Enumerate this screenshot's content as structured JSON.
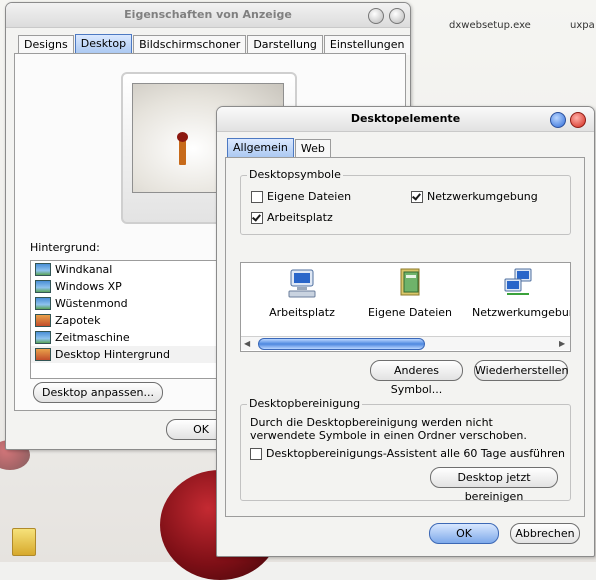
{
  "desktop": {
    "icon_labels": [
      "dxwebsetup.exe",
      "uxpa"
    ]
  },
  "display_properties": {
    "title": "Eigenschaften von Anzeige",
    "tabs": [
      "Designs",
      "Desktop",
      "Bildschirmschoner",
      "Darstellung",
      "Einstellungen"
    ],
    "active_tab": "Desktop",
    "background_label": "Hintergrund:",
    "backgrounds": [
      "Windkanal",
      "Windows XP",
      "Wüstenmond",
      "Zapotek",
      "Zeitmaschine",
      "Desktop Hintergrund"
    ],
    "customize_button": "Desktop anpassen...",
    "ok_button": "OK"
  },
  "desktop_items": {
    "title": "Desktopelemente",
    "tabs": [
      "Allgemein",
      "Web"
    ],
    "active_tab": "Allgemein",
    "icons_group": "Desktopsymbole",
    "checkboxes": [
      {
        "label": "Eigene Dateien",
        "checked": false
      },
      {
        "label": "Netzwerkumgebung",
        "checked": true
      },
      {
        "label": "Arbeitsplatz",
        "checked": true
      }
    ],
    "icon_items": [
      {
        "label": "Arbeitsplatz",
        "icon": "my-computer-icon"
      },
      {
        "label": "Eigene Dateien",
        "icon": "my-documents-icon"
      },
      {
        "label": "Netzwerkumgebung",
        "icon": "network-places-icon"
      }
    ],
    "change_icon_button": "Anderes Symbol...",
    "restore_button": "Wiederherstellen",
    "cleanup_group": "Desktopbereinigung",
    "cleanup_text": "Durch die Desktopbereinigung werden nicht verwendete Symbole in einen Ordner verschoben.",
    "cleanup_checkbox": {
      "label": "Desktopbereinigungs-Assistent alle 60 Tage ausführen",
      "checked": false
    },
    "cleanup_button": "Desktop jetzt bereinigen",
    "ok_button": "OK",
    "cancel_button": "Abbrechen"
  },
  "colors": {
    "accent": "#4d79c2",
    "close": "#d2281c"
  }
}
